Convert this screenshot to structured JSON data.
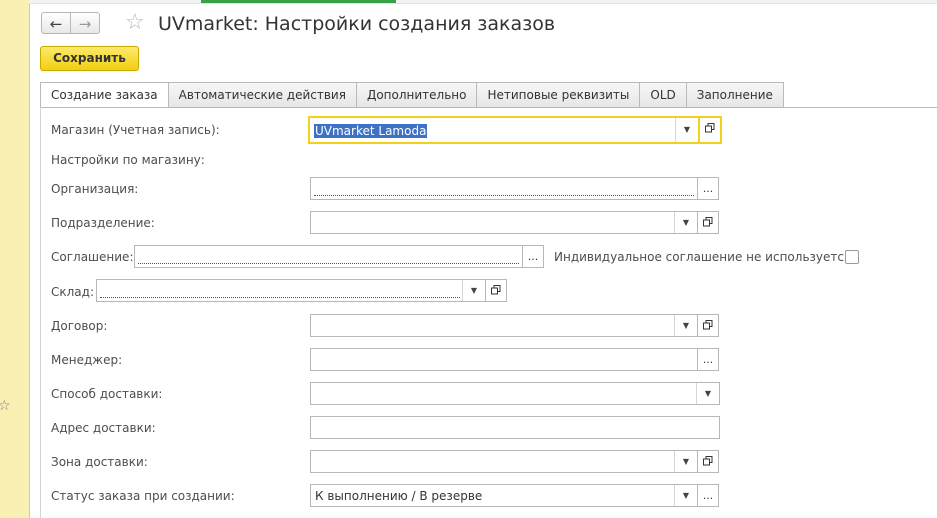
{
  "window": {
    "title": "UVmarket: Настройки создания заказов",
    "nav_back_icon": "arrow-left-icon",
    "nav_forward_icon": "arrow-right-icon",
    "favorite_icon": "star-icon"
  },
  "toolbar": {
    "save_label": "Сохранить"
  },
  "tabs": [
    {
      "label": "Создание заказа",
      "active": true
    },
    {
      "label": "Автоматические действия",
      "active": false
    },
    {
      "label": "Дополнительно",
      "active": false
    },
    {
      "label": "Нетиповые реквизиты",
      "active": false
    },
    {
      "label": "OLD",
      "active": false
    },
    {
      "label": "Заполнение",
      "active": false
    }
  ],
  "form": {
    "store": {
      "label": "Магазин (Учетная запись):",
      "value": "UVmarket Lamoda"
    },
    "store_settings_heading": "Настройки по магазину:",
    "organization": {
      "label": "Организация:",
      "value": ""
    },
    "department": {
      "label": "Подразделение:",
      "value": ""
    },
    "agreement": {
      "label": "Соглашение:",
      "value": ""
    },
    "individual_agreement": {
      "label": "Индивидуальное соглашение не используется:",
      "checked": false
    },
    "warehouse": {
      "label": "Склад:",
      "value": ""
    },
    "contract": {
      "label": "Договор:",
      "value": ""
    },
    "manager": {
      "label": "Менеджер:",
      "value": ""
    },
    "delivery_method": {
      "label": "Способ доставки:",
      "value": ""
    },
    "delivery_address": {
      "label": "Адрес доставки:",
      "value": ""
    },
    "delivery_zone": {
      "label": "Зона доставки:",
      "value": ""
    },
    "order_status": {
      "label": "Статус заказа при создании:",
      "value": "К выполнению / В резерве"
    }
  },
  "controls": {
    "dropdown_glyph": "▼",
    "select_glyph": "...",
    "open_icon": "open-form-icon"
  },
  "colors": {
    "accent": "#f2d11b",
    "left_panel": "#fbf0b3",
    "selection": "#3d72c7",
    "required_underline": "#d22020"
  }
}
